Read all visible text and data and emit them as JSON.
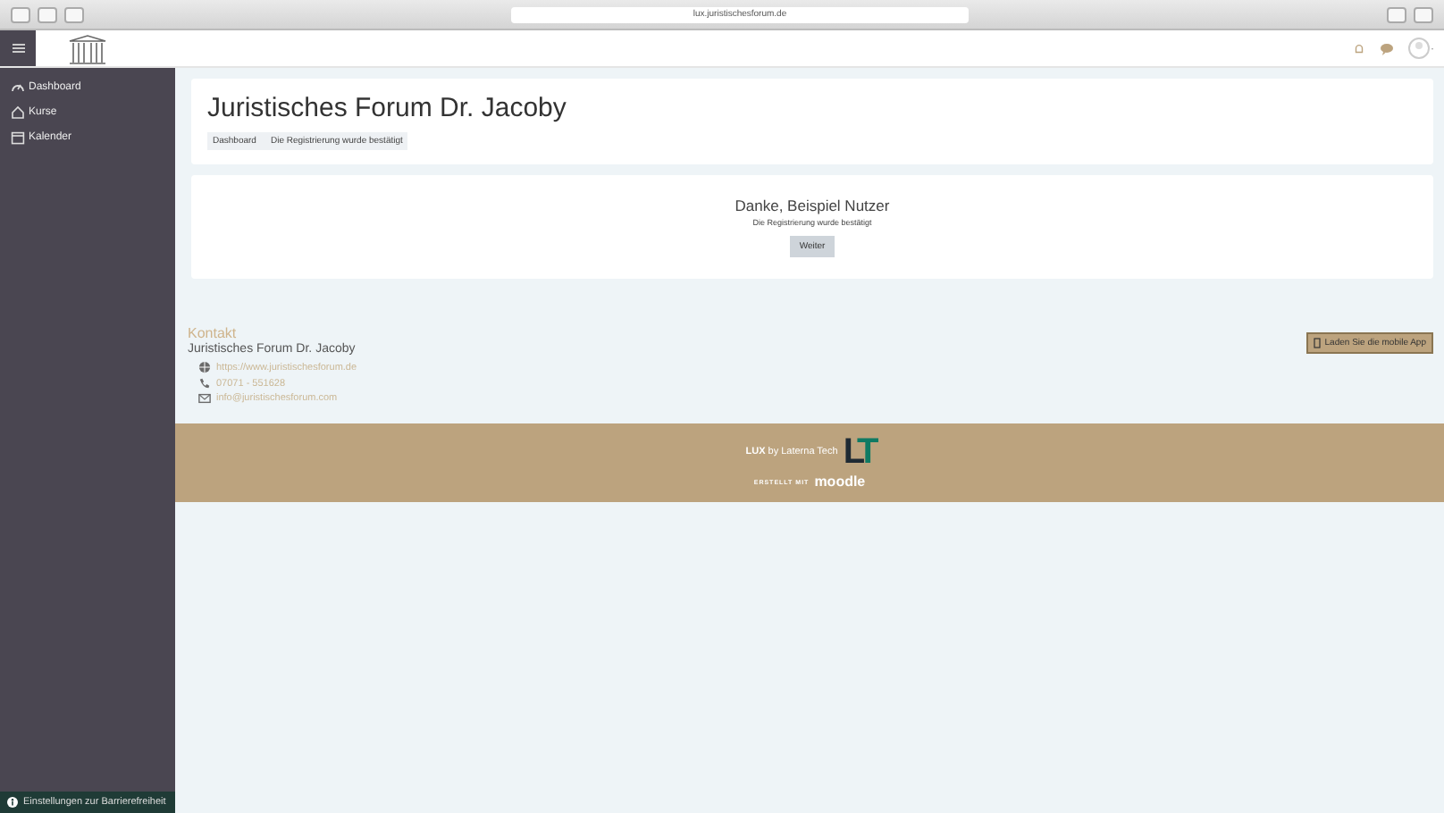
{
  "browser": {
    "url": "lux.juristischesforum.de"
  },
  "sidebar": {
    "items": [
      {
        "label": "Dashboard",
        "selected": false
      },
      {
        "label": "Kurse",
        "selected": false
      },
      {
        "label": "Kalender",
        "selected": false
      }
    ],
    "accessibility": "Einstellungen zur Barrierefreiheit"
  },
  "header": {
    "title": "Juristisches Forum Dr. Jacoby",
    "breadcrumb": [
      "Dashboard",
      "Die Registrierung wurde bestätigt"
    ]
  },
  "confirmation": {
    "heading": "Danke, Beispiel Nutzer",
    "message": "Die Registrierung wurde bestätigt",
    "button": "Weiter"
  },
  "contact": {
    "heading": "Kontakt",
    "name": "Juristisches Forum Dr. Jacoby",
    "lines": [
      {
        "text": "https://www.juristischesforum.de"
      },
      {
        "text": "07071 - 551628"
      },
      {
        "text": "info@juristischesforum.com"
      }
    ]
  },
  "mobile_app": "Laden Sie die mobile App",
  "footer": {
    "brand": "LUX",
    "by": "by Laterna Tech",
    "logo": "LT",
    "made_with": "ERSTELLT MIT",
    "moodle": "moodle"
  }
}
